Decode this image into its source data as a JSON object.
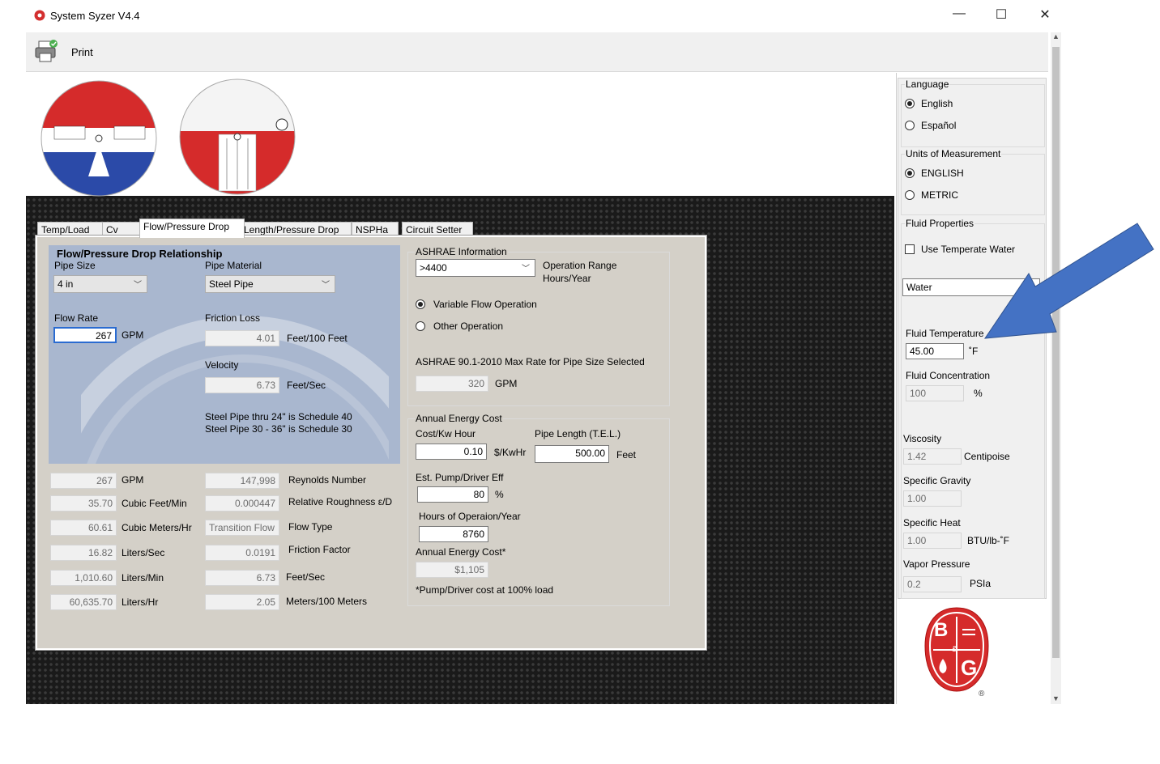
{
  "window": {
    "title": "System Syzer V4.4",
    "minimize": "—",
    "maximize": "☐",
    "close": "✕"
  },
  "toolbar": {
    "print_label": "Print"
  },
  "tabs": [
    "Temp/Load",
    "Cv",
    "Flow/Pressure Drop",
    "Length/Pressure Drop",
    "NSPHa",
    "Circuit Setter"
  ],
  "active_tab": "Flow/Pressure Drop",
  "flow": {
    "heading": "Flow/Pressure Drop Relationship",
    "pipe_size_label": "Pipe Size",
    "pipe_size": "4 in",
    "pipe_material_label": "Pipe Material",
    "pipe_material": "Steel Pipe",
    "flow_rate_label": "Flow Rate",
    "flow_rate": "267",
    "flow_rate_unit": "GPM",
    "friction_loss_label": "Friction Loss",
    "friction_loss": "4.01",
    "friction_loss_unit": "Feet/100 Feet",
    "velocity_label": "Velocity",
    "velocity": "6.73",
    "velocity_unit": "Feet/Sec",
    "schedule_note_1": "Steel Pipe thru 24\" is Schedule 40",
    "schedule_note_2": "Steel Pipe 30 - 36\" is Schedule 30"
  },
  "conversions_left": [
    {
      "value": "267",
      "unit": "GPM"
    },
    {
      "value": "35.70",
      "unit": "Cubic Feet/Min"
    },
    {
      "value": "60.61",
      "unit": "Cubic Meters/Hr"
    },
    {
      "value": "16.82",
      "unit": "Liters/Sec"
    },
    {
      "value": "1,010.60",
      "unit": "Liters/Min"
    },
    {
      "value": "60,635.70",
      "unit": "Liters/Hr"
    }
  ],
  "conversions_right": [
    {
      "value": "147,998",
      "unit": "Reynolds Number"
    },
    {
      "value": "0.000447",
      "unit": "Relative Roughness ε/D"
    },
    {
      "value": "Transition Flow",
      "unit": "Flow Type"
    },
    {
      "value": "0.0191",
      "unit": "Friction Factor"
    },
    {
      "value": "6.73",
      "unit": "Feet/Sec"
    },
    {
      "value": "2.05",
      "unit": "Meters/100 Meters"
    }
  ],
  "ashrae": {
    "title": "ASHRAE Information",
    "range": ">4400",
    "range_label_1": "Operation Range",
    "range_label_2": "Hours/Year",
    "variable_flow": "Variable Flow Operation",
    "other_operation": "Other Operation",
    "max_rate_label": "ASHRAE 90.1-2010 Max Rate for Pipe Size Selected",
    "max_rate": "320",
    "max_rate_unit": "GPM"
  },
  "energy": {
    "title": "Annual Energy Cost",
    "cost_label": "Cost/Kw Hour",
    "cost": "0.10",
    "cost_unit": "$/KwHr",
    "pipe_length_label": "Pipe Length (T.E.L.)",
    "pipe_length": "500.00",
    "pipe_length_unit": "Feet",
    "pump_eff_label": "Est. Pump/Driver Eff",
    "pump_eff": "80",
    "pump_eff_unit": "%",
    "hours_label": "Hours of Operaion/Year",
    "hours": "8760",
    "annual_label": "Annual Energy Cost*",
    "annual": "$1,105",
    "footnote": "*Pump/Driver cost at 100% load"
  },
  "sidebar": {
    "language_title": "Language",
    "english": "English",
    "espanol": "Español",
    "units_title": "Units of Measurement",
    "units_english": "ENGLISH",
    "units_metric": "METRIC",
    "fluid_title": "Fluid Properties",
    "temperate_water": "Use Temperate Water",
    "fluid": "Water",
    "fluid_temp_label": "Fluid Temperature",
    "fluid_temp": "45.00",
    "fluid_temp_unit": "˚F",
    "fluid_conc_label": "Fluid Concentration",
    "fluid_conc": "100",
    "fluid_conc_unit": "%",
    "viscosity_label": "Viscosity",
    "viscosity": "1.42",
    "viscosity_unit": "Centipoise",
    "sg_label": "Specific Gravity",
    "sg": "1.00",
    "sh_label": "Specific Heat",
    "sh": "1.00",
    "sh_unit": "BTU/lb-˚F",
    "vp_label": "Vapor Pressure",
    "vp": "0.2",
    "vp_unit": "PSIa"
  },
  "logo": {
    "letter_b": "B",
    "letter_g": "G",
    "amp": "&",
    "reg": "®"
  },
  "colors": {
    "arrow": "#4472c4",
    "brand_red": "#d32f2f",
    "blue_group": "#a9b7cf"
  }
}
